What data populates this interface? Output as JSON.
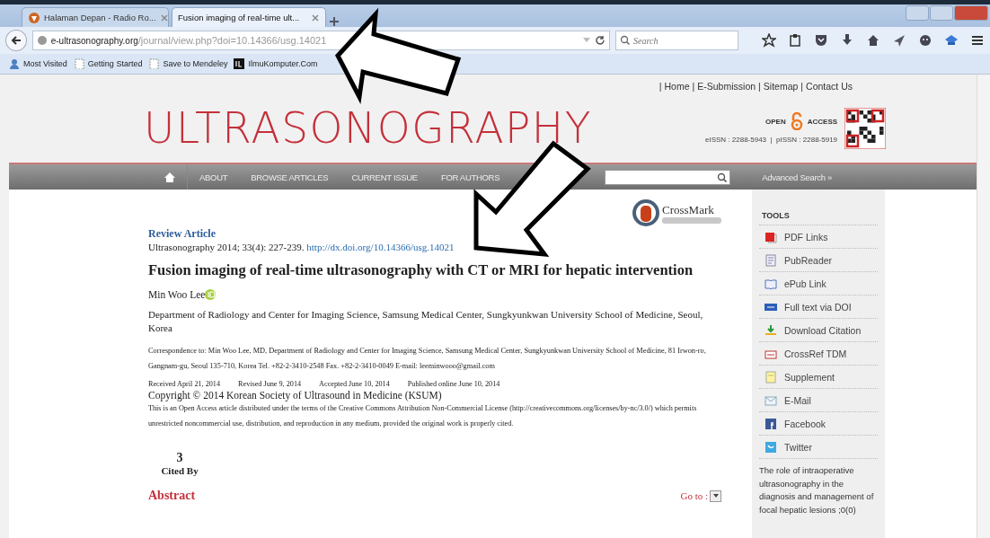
{
  "browser": {
    "tabs": [
      {
        "title": "Halaman Depan - Radio Ro...",
        "selected": false
      },
      {
        "title": "Fusion imaging of real-time ult...",
        "selected": true
      }
    ],
    "url": {
      "domain": "e-ultrasonography.org",
      "path": "/journal/view.php?doi=10.14366/usg.14021"
    },
    "search": {
      "placeholder": "Search"
    },
    "bookmarks": [
      {
        "label": "Most Visited",
        "kind": "person"
      },
      {
        "label": "Getting Started",
        "kind": "page"
      },
      {
        "label": "Save to Mendeley",
        "kind": "page"
      },
      {
        "label": "IlmuKomputer.Com",
        "kind": "logo"
      }
    ]
  },
  "site": {
    "top_links": [
      "Home",
      "E-Submission",
      "Sitemap",
      "Contact Us"
    ],
    "separator": "|",
    "logo": "ULTRASONOGRAPHY",
    "open_access": [
      "OPEN",
      "ACCESS"
    ],
    "issn": "eISSN : 2288-5943  |  pISSN : 2288-5919",
    "nav": [
      "ABOUT",
      "BROWSE ARTICLES",
      "CURRENT ISSUE",
      "FOR AUTHORS"
    ],
    "advanced_search": "Advanced Search »"
  },
  "article": {
    "type": "Review Article",
    "citation": "Ultrasonography 2014; 33(4): 227-239.",
    "doi": "http://dx.doi.org/10.14366/usg.14021",
    "crossmark": "CrossMark",
    "title": "Fusion imaging of real-time ultrasonography with CT or MRI for hepatic intervention",
    "author": "Min Woo Lee",
    "affiliation": "Department of Radiology and Center for Imaging Science, Samsung Medical Center, Sungkyunkwan University School of Medicine, Seoul, Korea",
    "correspondence": "Correspondence to: Min Woo Lee, MD, Department of Radiology and Center for Imaging Science, Samsung Medical Center, Sungkyunkwan University School of Medicine, 81 Irwon-ro, Gangnam-gu, Seoul 135-710, Korea Tel. +82-2-3410-2548 Fax. +82-2-3410-0049 E-mail: leeminwooo@gmail.com",
    "dates": [
      "Received April 21, 2014",
      "Revised June 9, 2014",
      "Accepted June 10, 2014",
      "Published online June 10, 2014"
    ],
    "copyright": "Copyright © 2014 Korean Society of Ultrasound in Medicine (KSUM)",
    "license": "This is an Open Access article distributed under the terms of the Creative Commons Attribution Non-Commercial License (http://creativecommons.org/licenses/by-nc/3.0/) which permits unrestricted noncommercial use, distribution, and reproduction in any medium, provided the original work is properly cited.",
    "cited_by": {
      "count": "3",
      "label": "Cited By"
    },
    "abstract": "Abstract",
    "goto": "Go to :"
  },
  "sidebar": {
    "heading": "TOOLS",
    "items": [
      {
        "label": "PDF Links",
        "kind": "pdf"
      },
      {
        "label": "PubReader",
        "kind": "reader"
      },
      {
        "label": "ePub Link",
        "kind": "book"
      },
      {
        "label": "Full text via DOI",
        "kind": "doi"
      },
      {
        "label": "Download Citation",
        "kind": "download"
      },
      {
        "label": "CrossRef TDM",
        "kind": "tdm"
      },
      {
        "label": "Supplement",
        "kind": "note"
      },
      {
        "label": "E-Mail",
        "kind": "mail"
      },
      {
        "label": "Facebook",
        "kind": "facebook"
      },
      {
        "label": "Twitter",
        "kind": "twitter"
      }
    ],
    "related": {
      "title": "The role of intraoperative ultrasonography in the diagnosis and management of focal hepatic lesions",
      "count": ";0(0)"
    }
  }
}
